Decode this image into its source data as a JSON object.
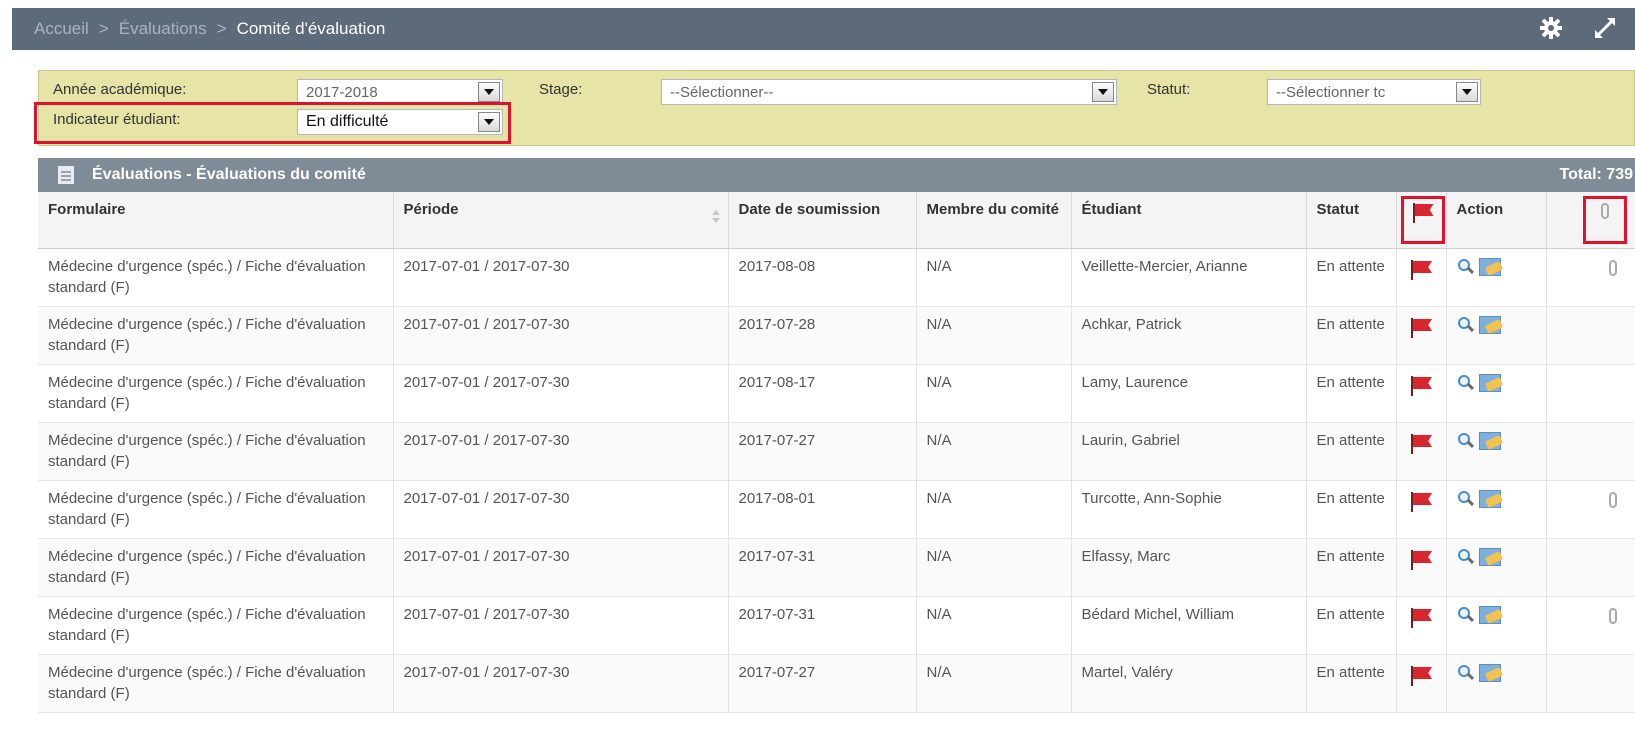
{
  "breadcrumb": {
    "items": [
      "Accueil",
      "Évaluations",
      "Comité d'évaluation"
    ],
    "separator": ">"
  },
  "header_icons": [
    "gear-icon",
    "expand-icon"
  ],
  "filters": {
    "academic_year_label": "Année académique:",
    "academic_year_value": "2017-2018",
    "stage_label": "Stage:",
    "stage_value": "--Sélectionner--",
    "status_label": "Statut:",
    "status_value": "--Sélectionner tc",
    "student_indicator_label": "Indicateur étudiant:",
    "student_indicator_value": "En difficulté"
  },
  "grid": {
    "title": "Évaluations - Évaluations du comité",
    "total": "Total: 739",
    "columns": [
      "Formulaire",
      "Période",
      "Date de soumission",
      "Membre du comité",
      "Étudiant",
      "Statut",
      "",
      "Action",
      ""
    ],
    "column_icons": {
      "flag_column": "flag-icon",
      "attachment_column": "paperclip-icon"
    },
    "rows": [
      {
        "form": "Médecine d'urgence (spéc.) / Fiche d'évaluation standard (F)",
        "period": "2017-07-01 / 2017-07-30",
        "date": "2017-08-08",
        "member": "N/A",
        "student": "Veillette-Mercier, Arianne",
        "status": "En attente",
        "attachment": true
      },
      {
        "form": "Médecine d'urgence (spéc.) / Fiche d'évaluation standard (F)",
        "period": "2017-07-01 / 2017-07-30",
        "date": "2017-07-28",
        "member": "N/A",
        "student": "Achkar, Patrick",
        "status": "En attente",
        "attachment": false
      },
      {
        "form": "Médecine d'urgence (spéc.) / Fiche d'évaluation standard (F)",
        "period": "2017-07-01 / 2017-07-30",
        "date": "2017-08-17",
        "member": "N/A",
        "student": "Lamy, Laurence",
        "status": "En attente",
        "attachment": false
      },
      {
        "form": "Médecine d'urgence (spéc.) / Fiche d'évaluation standard (F)",
        "period": "2017-07-01 / 2017-07-30",
        "date": "2017-07-27",
        "member": "N/A",
        "student": "Laurin, Gabriel",
        "status": "En attente",
        "attachment": false
      },
      {
        "form": "Médecine d'urgence (spéc.) / Fiche d'évaluation standard (F)",
        "period": "2017-07-01 / 2017-07-30",
        "date": "2017-08-01",
        "member": "N/A",
        "student": "Turcotte, Ann-Sophie",
        "status": "En attente",
        "attachment": true
      },
      {
        "form": "Médecine d'urgence (spéc.) / Fiche d'évaluation standard (F)",
        "period": "2017-07-01 / 2017-07-30",
        "date": "2017-07-31",
        "member": "N/A",
        "student": "Elfassy, Marc",
        "status": "En attente",
        "attachment": false
      },
      {
        "form": "Médecine d'urgence (spéc.) / Fiche d'évaluation standard (F)",
        "period": "2017-07-01 / 2017-07-30",
        "date": "2017-07-31",
        "member": "N/A",
        "student": "Bédard Michel, William",
        "status": "En attente",
        "attachment": true
      },
      {
        "form": "Médecine d'urgence (spéc.) / Fiche d'évaluation standard (F)",
        "period": "2017-07-01 / 2017-07-30",
        "date": "2017-07-27",
        "member": "N/A",
        "student": "Martel, Valéry",
        "status": "En attente",
        "attachment": false
      }
    ]
  },
  "colors": {
    "header_bar": "#5d6a79",
    "filter_panel": "#e6e4a6",
    "grid_title_bar": "#7f8b96",
    "highlight": "#e0112b",
    "flag": "#d9262e"
  }
}
